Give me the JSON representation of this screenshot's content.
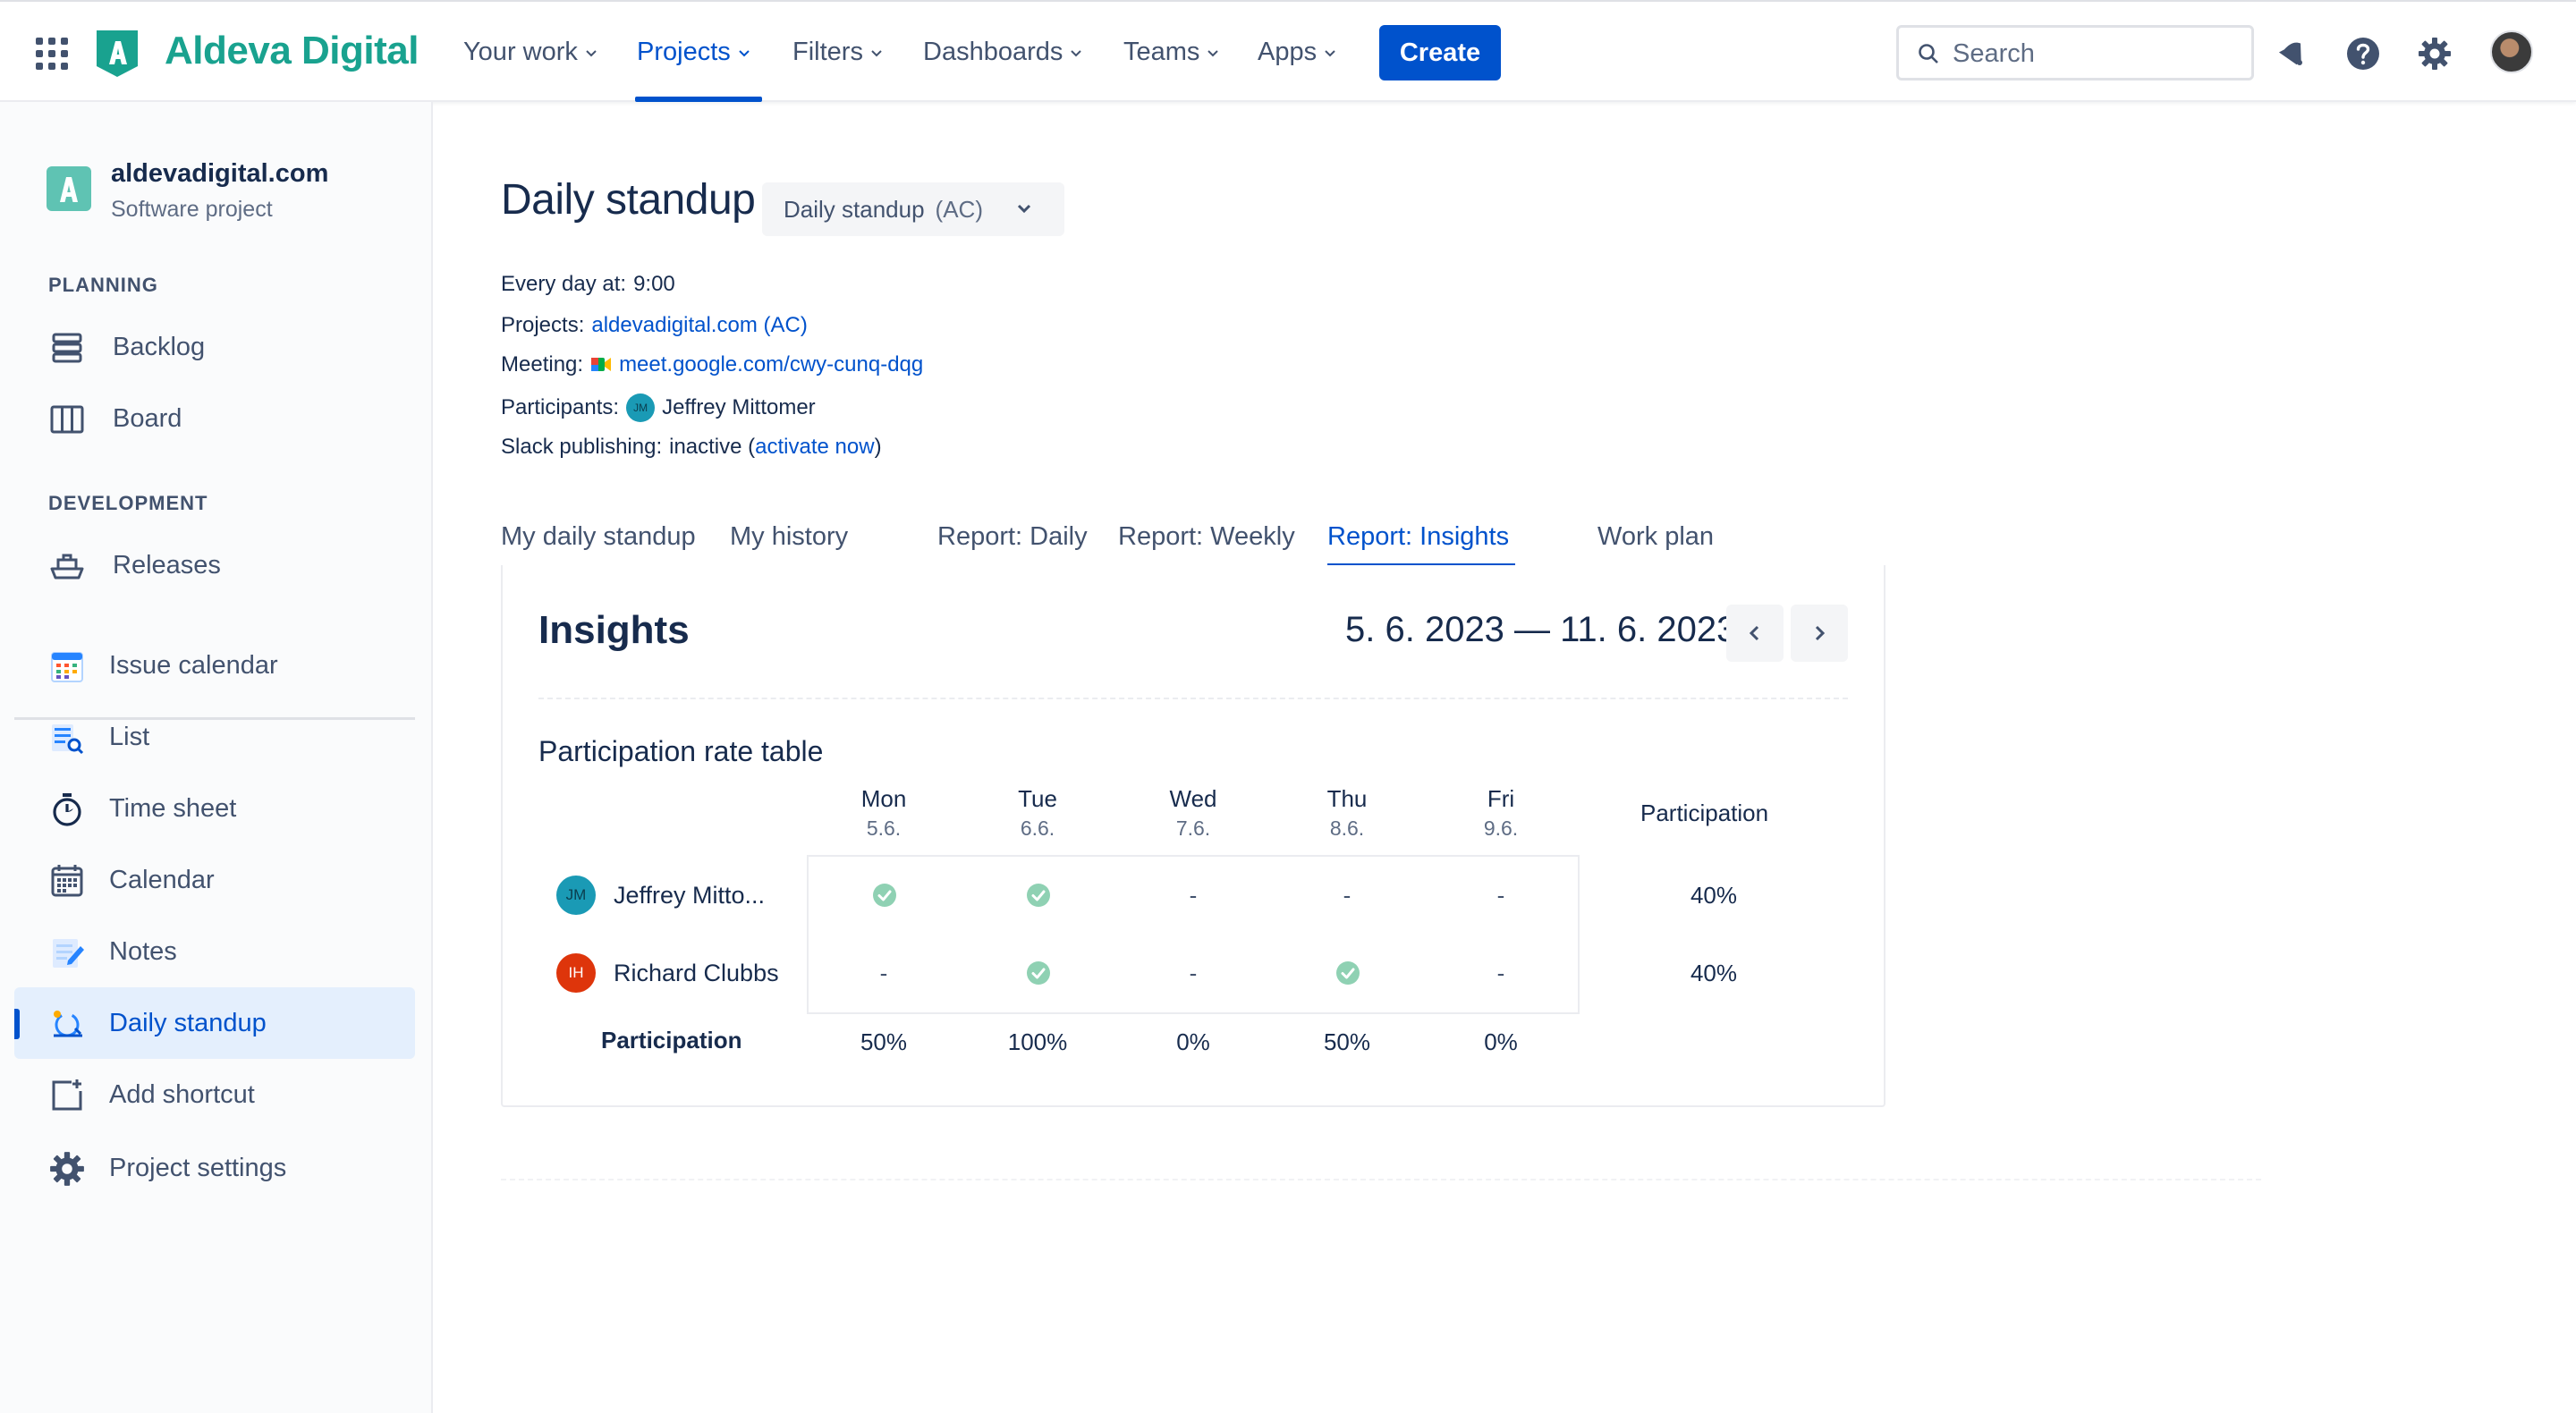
{
  "brand": {
    "name": "Aldeva Digital",
    "color": "#19a28f"
  },
  "nav": {
    "items": [
      {
        "label": "Your work"
      },
      {
        "label": "Projects"
      },
      {
        "label": "Filters"
      },
      {
        "label": "Dashboards"
      },
      {
        "label": "Teams"
      },
      {
        "label": "Apps"
      }
    ],
    "active": "Projects",
    "create_label": "Create",
    "search_placeholder": "Search"
  },
  "colors": {
    "primary": "#0052cc",
    "success": "#36b37e",
    "text": "#172b4d",
    "subtle": "#42526e"
  },
  "sidebar": {
    "project_name": "aldevadigital.com",
    "project_type": "Software project",
    "planning_heading": "PLANNING",
    "development_heading": "DEVELOPMENT",
    "planning": [
      {
        "label": "Backlog",
        "icon": "backlog-icon"
      },
      {
        "label": "Board",
        "icon": "board-icon"
      }
    ],
    "development": [
      {
        "label": "Releases",
        "icon": "ship-icon"
      }
    ],
    "apps": [
      {
        "label": "Issue calendar",
        "icon": "calendar-color-icon"
      },
      {
        "label": "List",
        "icon": "list-search-icon"
      },
      {
        "label": "Time sheet",
        "icon": "stopwatch-icon"
      },
      {
        "label": "Calendar",
        "icon": "calendar-grid-icon"
      },
      {
        "label": "Notes",
        "icon": "notes-icon"
      },
      {
        "label": "Daily standup",
        "icon": "standup-icon",
        "active": true
      },
      {
        "label": "Add shortcut",
        "icon": "add-shortcut-icon"
      },
      {
        "label": "Project settings",
        "icon": "gear-icon"
      }
    ]
  },
  "page": {
    "title": "Daily standup",
    "selector_label": "Daily standup",
    "selector_code": "(AC)",
    "schedule_key": "Every day at:",
    "schedule_value": "9:00",
    "projects_key": "Projects:",
    "projects_link": "aldevadigital.com (AC)",
    "meeting_key": "Meeting:",
    "meeting_link": "meet.google.com/cwy-cunq-dqg",
    "participants_key": "Participants:",
    "participant_initials": "JM",
    "participant_name": "Jeffrey Mittomer",
    "slack_key": "Slack publishing:",
    "slack_status": "inactive (",
    "slack_link": "activate now",
    "slack_close": ")"
  },
  "tabs": [
    {
      "label": "My daily standup"
    },
    {
      "label": "My history"
    },
    {
      "label": "Report: Daily"
    },
    {
      "label": "Report: Weekly"
    },
    {
      "label": "Report: Insights",
      "active": true
    },
    {
      "label": "Work plan"
    }
  ],
  "insights": {
    "title": "Insights",
    "date_range": "5. 6. 2023 — 11. 6. 2023",
    "table_title": "Participation rate table",
    "participation_header": "Participation",
    "days": [
      {
        "day": "Mon",
        "date": "5.6."
      },
      {
        "day": "Tue",
        "date": "6.6."
      },
      {
        "day": "Wed",
        "date": "7.6."
      },
      {
        "day": "Thu",
        "date": "8.6."
      },
      {
        "day": "Fri",
        "date": "9.6."
      }
    ],
    "rows": [
      {
        "initials": "JM",
        "name": "Jeffrey Mitto...",
        "avatar_color": "#1a9ab5",
        "cells": [
          "check",
          "check",
          "-",
          "-",
          "-"
        ],
        "rate": "40%"
      },
      {
        "initials": "IH",
        "name": "Richard Clubbs",
        "avatar_color": "#de350b",
        "cells": [
          "-",
          "check",
          "-",
          "check",
          "-"
        ],
        "rate": "40%"
      }
    ],
    "footer_label": "Participation",
    "footer_values": [
      "50%",
      "100%",
      "0%",
      "50%",
      "0%"
    ]
  }
}
